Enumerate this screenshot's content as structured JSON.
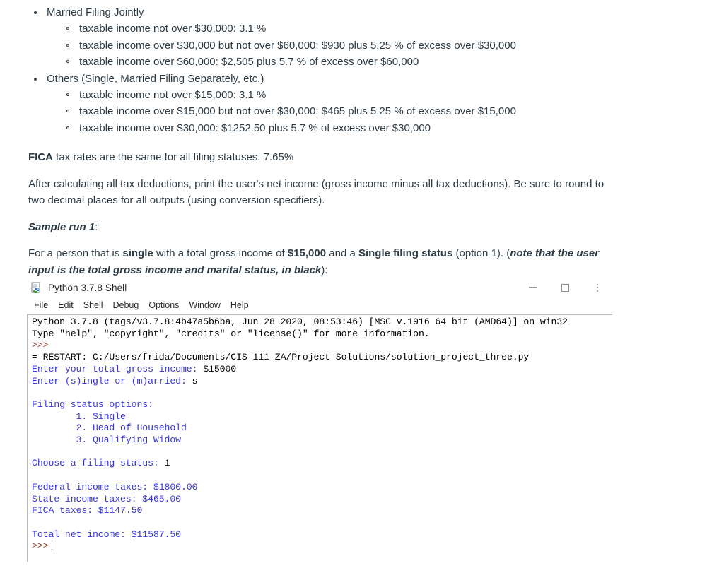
{
  "document": {
    "bullets": [
      {
        "label": "Married Filing Jointly",
        "items": [
          "taxable income not over $30,000: 3.1 %",
          "taxable income over $30,000 but not over $60,000: $930 plus 5.25 % of excess over $30,000",
          "taxable income over $60,000: $2,505 plus 5.7 % of excess over $60,000"
        ]
      },
      {
        "label": "Others (Single, Married Filing Separately, etc.)",
        "items": [
          "taxable income not over $15,000: 3.1 %",
          "taxable income over $15,000 but not over $30,000: $465 plus 5.25 % of excess over $15,000",
          "taxable income over $30,000: $1252.50 plus 5.7 % of excess over $30,000"
        ]
      }
    ],
    "fica": {
      "strong": "FICA",
      "rest": " tax rates are the same for all filing statuses: 7.65%"
    },
    "instructions": "After calculating all tax deductions, print the user's net income (gross income minus all tax deductions). Be sure to round to two decimal places for all outputs (using conversion specifiers).",
    "sample_run_heading": "Sample run 1",
    "sample_run_heading_suffix": ":",
    "sample_desc": {
      "p1": "For a person that is ",
      "b1": "single",
      "p2": " with a total gross income of ",
      "b2": "$15,000",
      "p3": " and a ",
      "b3": "Single filing status",
      "p4": " (option 1). (",
      "note": "note that the user input is the total gross income and marital status, in black",
      "p5": "):"
    }
  },
  "idle": {
    "title": "Python 3.7.8 Shell",
    "menu": [
      "File",
      "Edit",
      "Shell",
      "Debug",
      "Options",
      "Window",
      "Help"
    ],
    "window_controls": {
      "minimize": "minimize",
      "maximize": "maximize",
      "more": "more-options"
    },
    "console": {
      "banner_line_1": "Python 3.7.8 (tags/v3.7.8:4b47a5b6ba, Jun 28 2020, 08:53:46) [MSC v.1916 64 bit (AMD64)] on win32",
      "banner_line_2": "Type \"help\", \"copyright\", \"credits\" or \"license()\" for more information.",
      "prompt_1": ">>>",
      "restart_line": "= RESTART: C:/Users/frida/Documents/CIS 111 ZA/Project Solutions/solution_project_three.py",
      "prompt_income_label": "Enter your total gross income: ",
      "prompt_income_value": "$15000",
      "prompt_marital_label": "Enter (s)ingle or (m)arried: ",
      "prompt_marital_value": "s",
      "blank_1": "",
      "filing_header": "Filing status options:",
      "filing_options": [
        "        1. Single",
        "        2. Head of Household",
        "        3. Qualifying Widow"
      ],
      "blank_2": "",
      "choose_label": "Choose a filing status: ",
      "choose_value": "1",
      "blank_3": "",
      "federal_line": "Federal income taxes: $1800.00",
      "state_line": "State income taxes: $465.00",
      "fica_line": "FICA taxes: $1147.50",
      "blank_4": "",
      "total_line": "Total net income: $11587.50",
      "prompt_2": ">>>"
    },
    "colors": {
      "output_blue": "#3636d6",
      "prompt_red": "#9b3b2a",
      "input_black": "#000000"
    }
  }
}
